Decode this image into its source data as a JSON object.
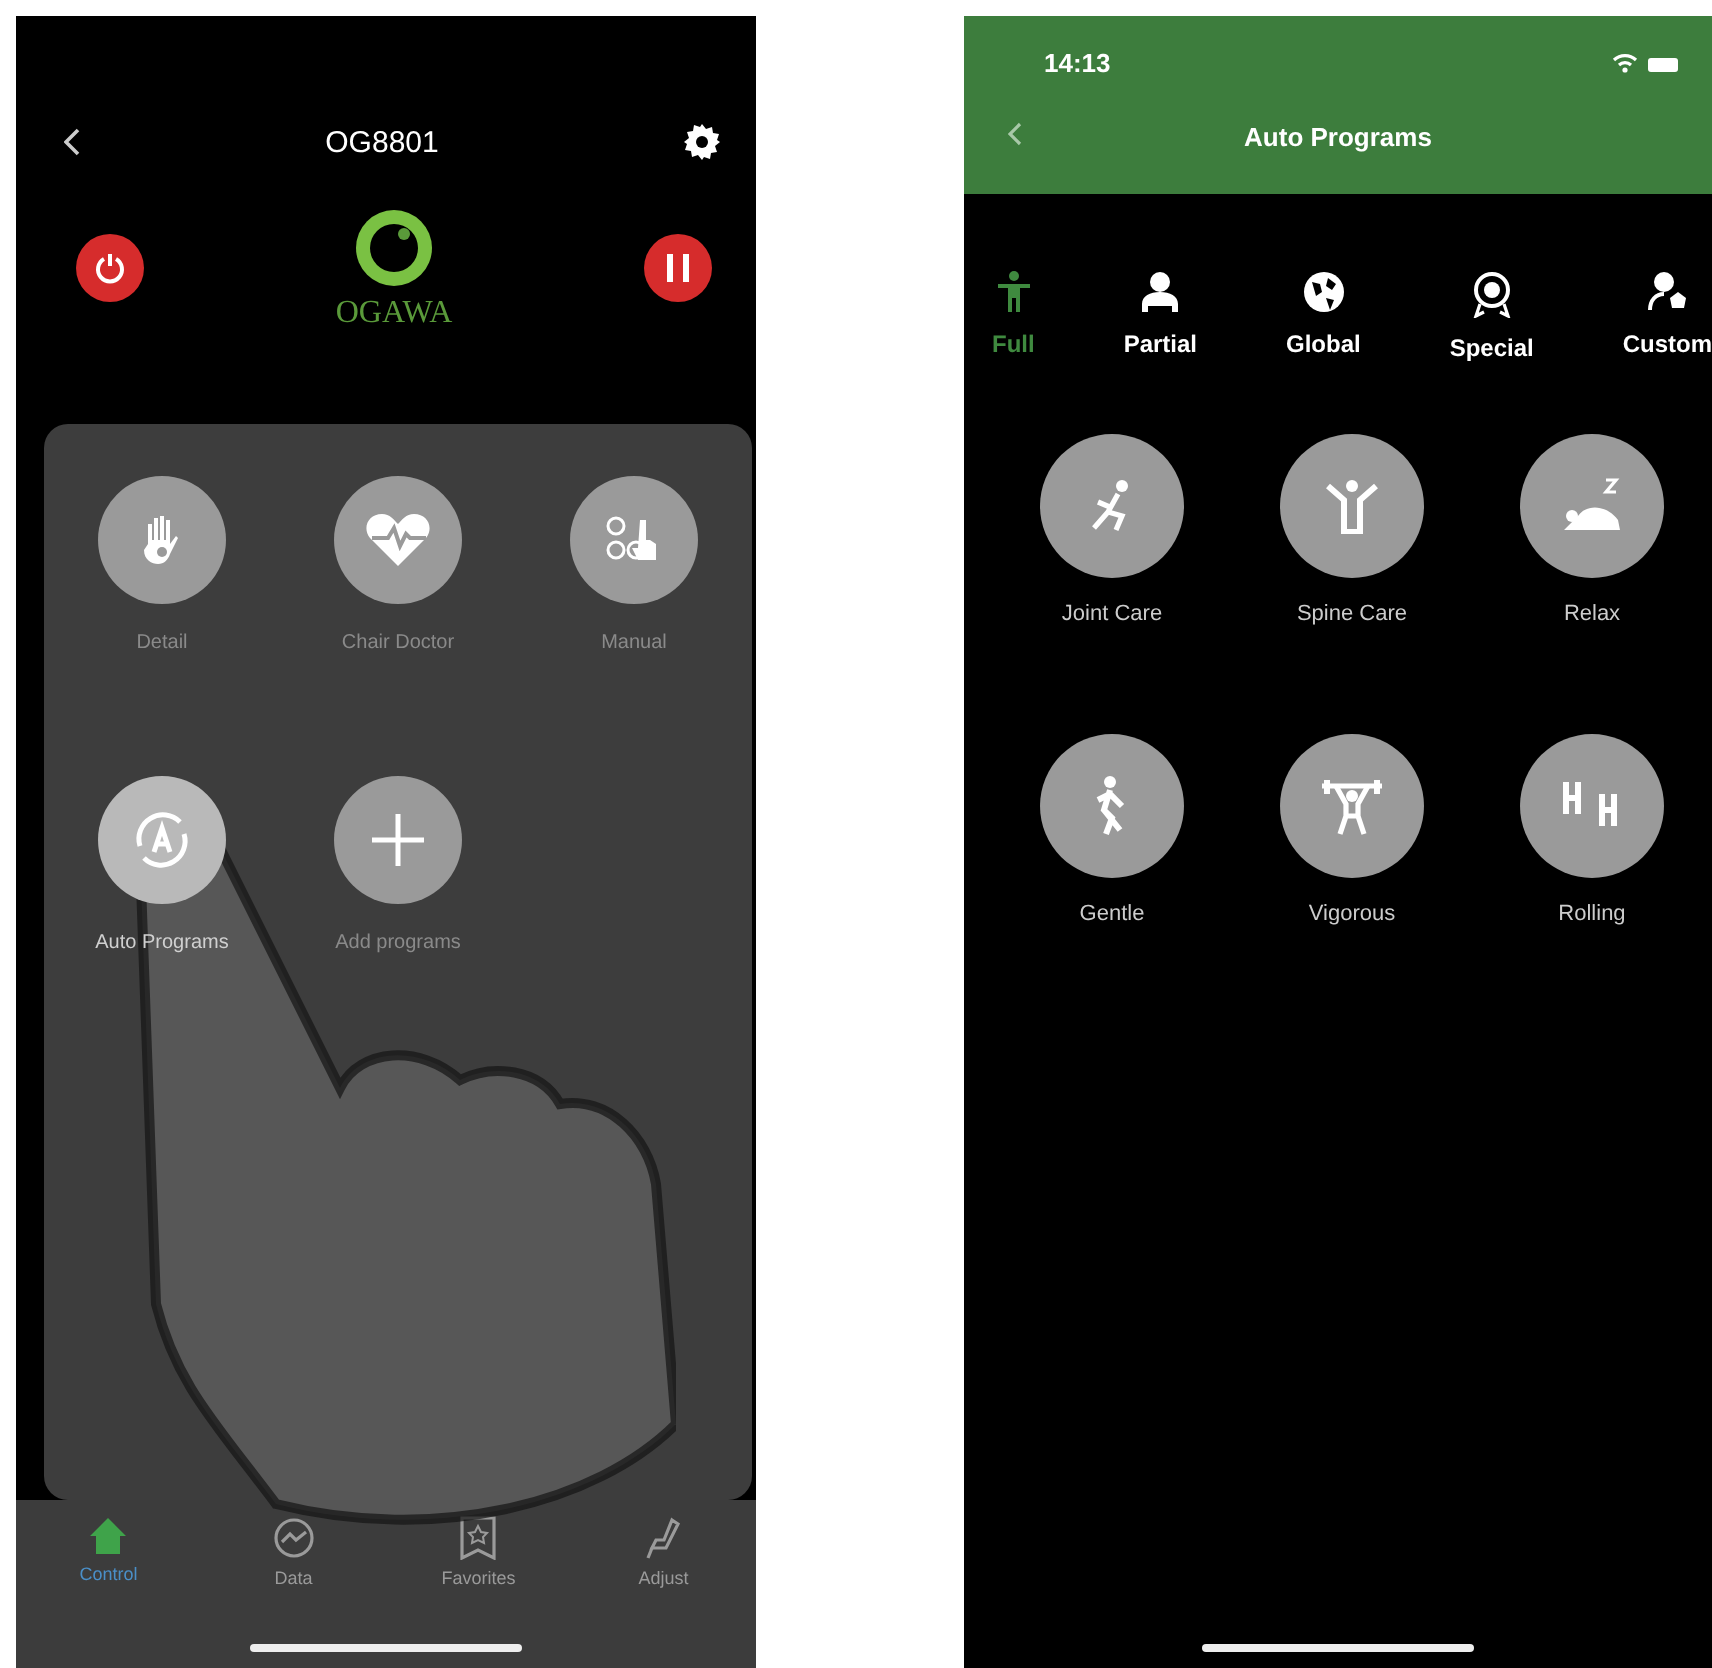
{
  "control_screen": {
    "device_title": "OG8801",
    "logo_text": "OGAWA",
    "power_button": {
      "kind": "power"
    },
    "pause_button": {
      "kind": "pause"
    },
    "modes": [
      {
        "label": "Detail",
        "kind": "hand",
        "selected": false
      },
      {
        "label": "Chair Doctor",
        "kind": "heart",
        "selected": false
      },
      {
        "label": "Manual",
        "kind": "manual",
        "selected": false
      },
      {
        "label": "Auto Programs",
        "kind": "auto",
        "selected": true
      },
      {
        "label": "Add programs",
        "kind": "add",
        "selected": false
      }
    ],
    "bottom_nav": [
      {
        "label": "Control",
        "kind": "home",
        "selected": true
      },
      {
        "label": "Data",
        "kind": "chart",
        "selected": false
      },
      {
        "label": "Favorites",
        "kind": "star",
        "selected": false
      },
      {
        "label": "Adjust",
        "kind": "chair",
        "selected": false
      }
    ]
  },
  "programs_screen": {
    "status_time": "14:13",
    "title": "Auto Programs",
    "categories": [
      {
        "label": "Full",
        "kind": "full",
        "selected": true
      },
      {
        "label": "Partial",
        "kind": "partial",
        "selected": false
      },
      {
        "label": "Global",
        "kind": "global",
        "selected": false
      },
      {
        "label": "Special",
        "kind": "special",
        "selected": false
      },
      {
        "label": "Custom",
        "kind": "custom",
        "selected": false
      }
    ],
    "programs": [
      {
        "label": "Joint Care",
        "kind": "joint"
      },
      {
        "label": "Spine Care",
        "kind": "spine"
      },
      {
        "label": "Relax",
        "kind": "relax"
      },
      {
        "label": "Gentle",
        "kind": "gentle"
      },
      {
        "label": "Vigorous",
        "kind": "vigorous"
      },
      {
        "label": "Rolling",
        "kind": "rolling"
      }
    ]
  }
}
